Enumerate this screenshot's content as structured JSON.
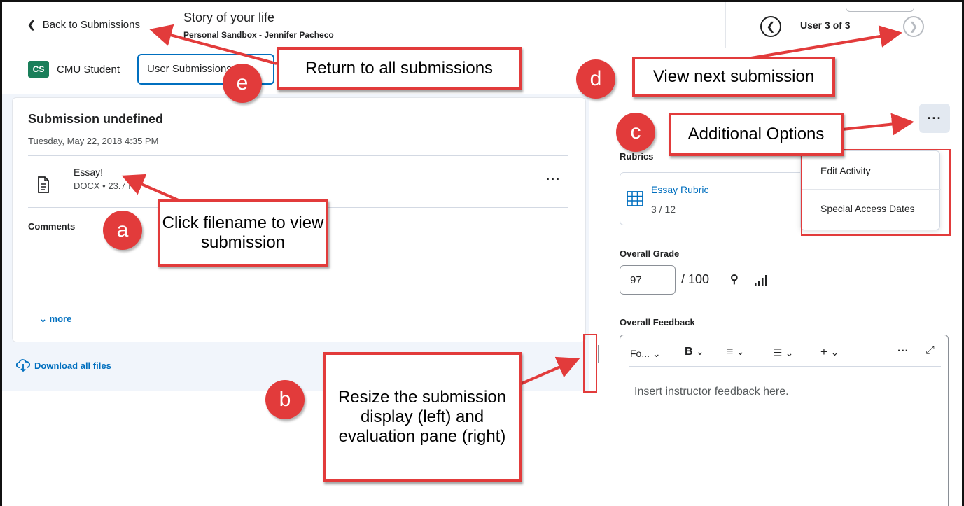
{
  "header": {
    "back_label": "Back to Submissions",
    "title": "Story of your life",
    "subtitle": "Personal Sandbox - Jennifer Pacheco",
    "user_count": "User 3 of 3"
  },
  "user_bar": {
    "badge": "CS",
    "name": "CMU Student",
    "select_value": "User Submissions"
  },
  "submission": {
    "title": "Submission undefined",
    "date": "Tuesday, May 22, 2018 4:35 PM",
    "file_name": "Essay!",
    "file_type": "DOCX",
    "file_size": "23.7 KB",
    "comments_label": "Comments",
    "more_label": "more",
    "download_label": "Download all files"
  },
  "evaluation": {
    "rubrics_label": "Rubrics",
    "rubric_name": "Essay Rubric",
    "rubric_score": "3 / 12",
    "grade_label": "Overall Grade",
    "grade_value": "97",
    "grade_out_of": "/ 100",
    "feedback_label": "Overall Feedback",
    "toolbar": {
      "font": "Fo...",
      "bold": "B",
      "align": "≡",
      "list": "☰",
      "insert": "+"
    },
    "feedback_placeholder": "Insert instructor feedback here.",
    "options_menu": [
      "Edit Activity",
      "Special Access Dates"
    ]
  },
  "annotations": {
    "a": {
      "letter": "a",
      "text": "Click filename to view submission"
    },
    "b": {
      "letter": "b",
      "text": "Resize the submission display (left) and evaluation pane (right)"
    },
    "c": {
      "letter": "c",
      "text": "Additional Options"
    },
    "d": {
      "letter": "d",
      "text": "View next submission"
    },
    "e": {
      "letter": "e",
      "text": "Return to all submissions"
    }
  },
  "colors": {
    "accent": "#006fbf",
    "annotation_red": "#e23b3b",
    "badge_green": "#1a7f5a"
  }
}
